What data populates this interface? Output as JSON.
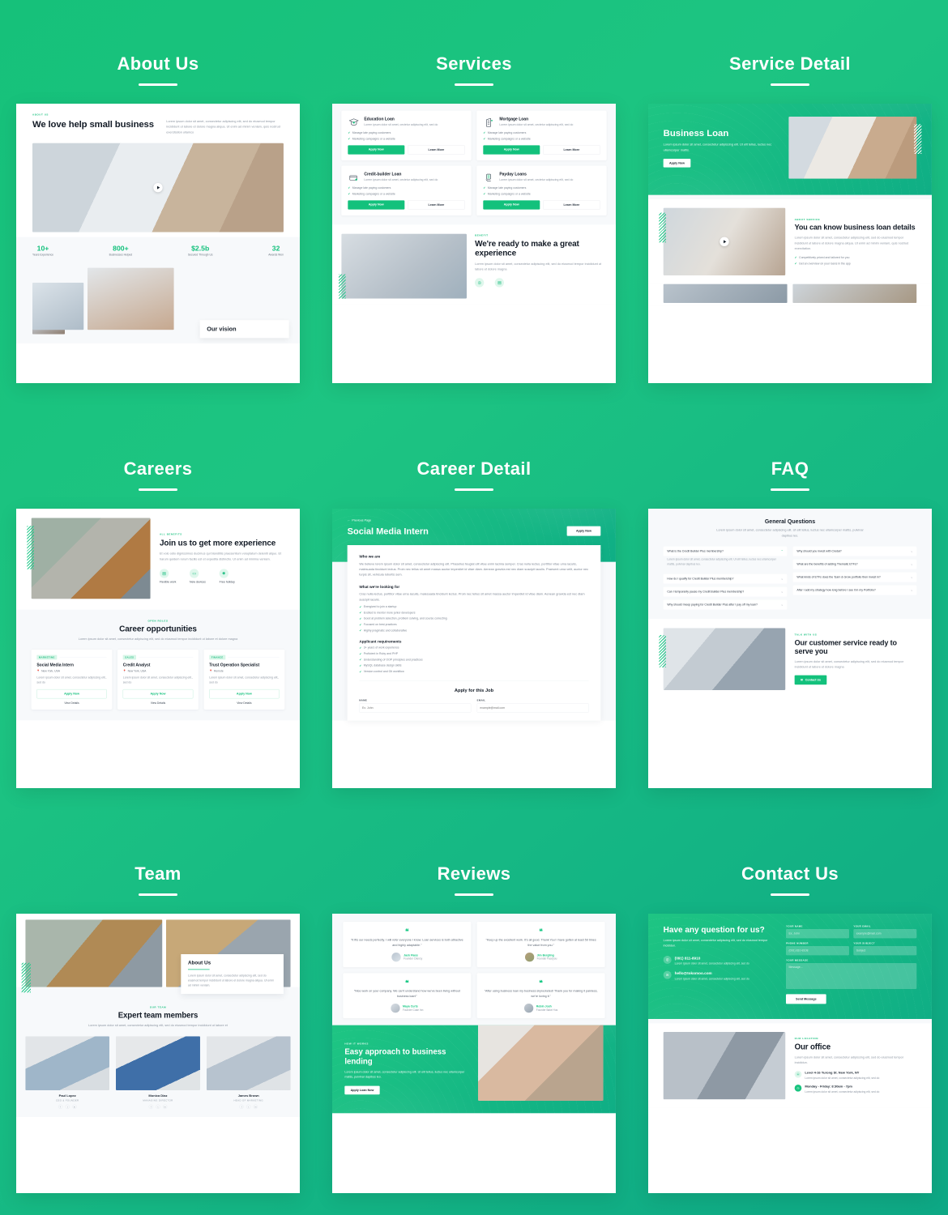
{
  "palette": {
    "brand": "#16c17a",
    "brand_dark": "#0ea885",
    "dark": "#141c27",
    "muted": "#8e97a3"
  },
  "sections": [
    {
      "title": "About Us"
    },
    {
      "title": "Services"
    },
    {
      "title": "Service Detail"
    },
    {
      "title": "Careers"
    },
    {
      "title": "Career Detail"
    },
    {
      "title": "FAQ"
    },
    {
      "title": "Team"
    },
    {
      "title": "Reviews"
    },
    {
      "title": "Contact Us"
    }
  ],
  "about": {
    "eyebrow": "ABOUT US",
    "heading": "We love help small business",
    "paragraph": "Lorem ipsum dolor sit amet, consectetur adipiscing elit, sed do eiusmod tempor incididunt ut labore et dolore magna aliqua. Ut enim ad minim veniam, quis nostrud exercitation ullamco",
    "stats": [
      {
        "value": "10+",
        "label": "Years Experience"
      },
      {
        "value": "800+",
        "label": "Businesses Helped"
      },
      {
        "value": "$2.5b",
        "label": "Secured Through Us"
      },
      {
        "value": "32",
        "label": "Awards Won"
      }
    ],
    "vision_title": "Our vision"
  },
  "services": {
    "cards": [
      {
        "title": "Education Loan",
        "desc": "Lorem ipsum dolor sit amet, cectetur adipiscing elit, sed do",
        "features": [
          "Manage late paying customers",
          "Marketing campaigns or a website"
        ],
        "apply": "Apply Now",
        "learn": "Learn More",
        "icon": "graduation-cap-icon"
      },
      {
        "title": "Mortgage Loan",
        "desc": "Lorem ipsum dolor sit amet, cectetur adipiscing elit, sed do",
        "features": [
          "Manage late paying customers",
          "Marketing campaigns or a website"
        ],
        "apply": "Apply Now",
        "learn": "Learn More",
        "icon": "building-icon"
      },
      {
        "title": "Credit-builder Loan",
        "desc": "Lorem ipsum dolor sit amet, cectetur adipiscing elit, sed do",
        "features": [
          "Manage late paying customers",
          "Marketing campaigns or a website"
        ],
        "apply": "Apply Now",
        "learn": "Learn More",
        "icon": "credit-card-icon"
      },
      {
        "title": "Payday Loans",
        "desc": "Lorem ipsum dolor sit amet, cectetur adipiscing elit, sed do",
        "features": [
          "Manage late paying customers",
          "Marketing campaigns or a website"
        ],
        "apply": "Apply Now",
        "learn": "Learn More",
        "icon": "cash-hand-icon"
      }
    ],
    "benefit": {
      "eyebrow": "BENEFIT",
      "heading": "We're ready to make a great experience",
      "paragraph": "Lorem ipsum dolor sit amet, consectetur adipiscing elit, sed do eiusmod tempor incididunt ut labore et dolore magna"
    }
  },
  "service_detail": {
    "hero_title": "Business Loan",
    "hero_paragraph": "Lorem ipsum dolor sit amet, consectetur adipiscing elit. Ut elit tellus, luctus nec ullamcorper mattis.",
    "hero_button": "Apply Now",
    "eyebrow": "ABOUT SERVICE",
    "heading": "You can know business loan details",
    "paragraph": "Lorem ipsum dolor sit amet, consectetur adipiscing elit, sed do eiusmod tempor incididunt ut labore et dolore magna aliqua. Ut enim ad minim veniam, quis nostrud exercitation.",
    "features": [
      "Competitively priced and tailored for you",
      "Get an overview on your loans in the app"
    ]
  },
  "careers": {
    "eyebrow": "ALL BENEFITS",
    "heading": "Join us to get more experience",
    "paragraph": "Et volo odio dignissimos ducimus qui blanditiis praesentium voluptatum deleniti atque. Et harum quidem rerum facilis est et expedita distinctio. Ut enim ad minima veniam.",
    "benefits": [
      {
        "label": "Flexible work",
        "icon": "calendar-icon"
      },
      {
        "label": "New devices",
        "icon": "laptop-icon"
      },
      {
        "label": "Free holiday",
        "icon": "sun-icon"
      }
    ],
    "roles_eyebrow": "OPEN ROLES",
    "roles_heading": "Career opportunities",
    "roles_paragraph": "Lorem ipsum dolor sit amet, consectetur adipiscing elit, sed do eiusmod tempor incididunt ut labore et dolore magna",
    "roles": [
      {
        "tag": "MARKETING",
        "title": "Social Media Intern",
        "location": "New York, USA",
        "desc": "Lorem ipsum dolor sit amet, consectetur adipiscing elit., sed do",
        "apply": "Apply Now",
        "details": "View Details"
      },
      {
        "tag": "SALES",
        "title": "Credit Analyst",
        "location": "New York, USA",
        "desc": "Lorem ipsum dolor sit amet, consectetur adipiscing elit., sed do",
        "apply": "Apply Now",
        "details": "View Details"
      },
      {
        "tag": "FINANCE",
        "title": "Trust Operation Specialist",
        "location": "Remote",
        "desc": "Lorem ipsum dolor sit amet, consectetur adipiscing elit., sed do",
        "apply": "Apply Now",
        "details": "View Details"
      }
    ]
  },
  "career_detail": {
    "back": "Previous Page",
    "title": "Social Media Intern",
    "apply_button": "Apply Now",
    "who_title": "Who we are",
    "who_text": "We believe lorem ipsum dolor sit amet, consectetur adipiscing elit. Phasellus feugiat elit vitae enim lacinia semper. Cras nulla lectus, porttitor vitae urna iaculis, malesuada tincidunt lectus. Proin nec tellus sit amet massa auctor imperdiet id vitae diam. Aenean gravida est nec diam suscipit iaculis. Praesent urna velit, auctor nec turpis sit, vehicula lobortis sem.",
    "looking_title": "What we're looking for",
    "looking_text": "Cras nulla lectus, porttitor vitae urna iaculis, malesuada tincidunt lectus. Proin nec tellus sit amet massa auctor imperdiet id vitae diam. Aenean gravida est nec diam suscipit iaculis.",
    "looking_items": [
      "Energized to join a startup",
      "Excited to mentor more junior developers",
      "Good at problem selection, problem solving, and course correcting",
      "Focused on best practices",
      "Highly pragmatic and collaborative"
    ],
    "req_title": "Applicant requirements",
    "req_items": [
      "3+ years of work experience",
      "Proficient in Ruby and PHP",
      "Understanding of OOP principles and practices",
      "MySQL database design skills",
      "Version control and Git workflow"
    ],
    "form_title": "Apply for this Job",
    "fields": [
      {
        "label": "NAME",
        "placeholder": "Ex. John"
      },
      {
        "label": "EMAIL",
        "placeholder": "example@mail.com"
      }
    ]
  },
  "faq": {
    "heading": "General Questions",
    "paragraph": "Lorem ipsum dolor sit amet, consectetur adipiscing elit. Ut elit tellus, luctus nec ullamcorper mattis, pulvinar dapibus leo.",
    "left_items": [
      {
        "q": "What is the Credit Builder Plus membership?",
        "open": true,
        "a": "Lorem ipsum dolor sit amet, consectetur adipiscing elit. Ut elit tellus, luctus nec ullamcorper mattis, pulvinar dapibus leo."
      },
      {
        "q": "How do I qualify for Credit Builder Plus membership?",
        "open": false
      },
      {
        "q": "Can I temporarily pause my Credit Builder Plus membership?",
        "open": false
      },
      {
        "q": "Why should I keep paying for Credit Builder Plus after I pay off my loan?",
        "open": false
      }
    ],
    "right_items": [
      {
        "q": "Why should you invest with Credai?",
        "open": false
      },
      {
        "q": "What are the benefits of adding Thematic ETFs?",
        "open": false
      },
      {
        "q": "What kinds of ETFs does the 'Earn & Grow portfolio then invest in?",
        "open": false
      },
      {
        "q": "After I add my strategy how long before I see it in my Portfolio?",
        "open": false
      }
    ],
    "cta_eyebrow": "TALK WITH US",
    "cta_heading": "Our customer service ready to serve you",
    "cta_paragraph": "Lorem ipsum dolor sit amet, consectetur adipiscing elit, sed do eiusmod tempor incididunt ut labore et dolore magna",
    "cta_button": "Contact Us"
  },
  "team": {
    "about_title": "About Us",
    "about_text": "Lorem ipsum dolor sit amet, consectetur adipiscing elit, sed do eiusmod tempor incididunt ut labore et dolore magna aliqua. Ut enim ad minim veniam.",
    "eyebrow": "OUR TEAM",
    "heading": "Expert team members",
    "paragraph": "Lorem ipsum dolor sit amet, consectetur adipiscing elit, sed do eiusmod tempor incididunt ut labore et",
    "members": [
      {
        "name": "Paul Lopez",
        "role": "CEO & FOUNDER"
      },
      {
        "name": "Monica Diaz",
        "role": "MANAGING DIRECTOR"
      },
      {
        "name": "James Brown",
        "role": "HEAD OF MARKETING"
      }
    ],
    "socials": [
      "facebook-icon",
      "twitter-icon",
      "linkedin-icon"
    ]
  },
  "reviews": {
    "items": [
      {
        "quote": "\"It fits our needs perfectly. I will refer everyone I know. Loan services is both attractive and highly adaptable.\"",
        "name": "Jack Flass",
        "role": "Founder Cliency"
      },
      {
        "quote": "\"Keep up the excellent work. It's all good. Thank You! I have gotten at least 50 times the value from you.\"",
        "name": "Jim Bergling",
        "role": "Founder Faceyou"
      },
      {
        "quote": "\"Nice work on your company. We can't understand how we've been living without business loan!\"",
        "name": "Maya Curts",
        "role": "Founder Cake Inn"
      },
      {
        "quote": "\"After using business loan my business skyrocketed! Thank you for making it painless, we're loving it.\"",
        "name": "Robin Josh",
        "role": "Founder Bake Hus"
      }
    ],
    "cta_eyebrow": "HOW IT WORKS",
    "cta_heading": "Easy approach to business lending",
    "cta_paragraph": "Lorem ipsum dolor sit amet, consectetur adipiscing elit. Ut elit tellus, luctus nec ullamcorper mattis, pulvinar dapibus leo.",
    "cta_button": "Apply Loan Now"
  },
  "contact": {
    "heading": "Have any question for us?",
    "paragraph": "Lorem ipsum dolor sit amet, consectetur adipiscing elit, sed do eiusmod tempor incididun.",
    "phone": "(091) 811-8910",
    "phone_note": "Lorem ipsum dolor sit amet, consectetur adipiscing elit, sed do",
    "email": "hello@tokomoo.com",
    "email_note": "Lorem ipsum dolor sit amet, consectetur adipiscing elit, sed do",
    "fields": [
      {
        "label": "YOUR NAME",
        "placeholder": "Ex. John"
      },
      {
        "label": "YOUR EMAIL",
        "placeholder": "example@mail.com"
      },
      {
        "label": "PHONE NUMBER",
        "placeholder": "(091) 810-8108"
      },
      {
        "label": "YOUR SUBJECT",
        "placeholder": "Subject"
      }
    ],
    "message_label": "YOUR MESSAGE",
    "message_placeholder": "Message...",
    "send_button": "Send Message",
    "office_eyebrow": "OUR LOCATION",
    "office_heading": "Our office",
    "office_paragraph": "Lorem ipsum dolor sit amet, consectetur adipiscing elit, sed do eiusmod tempor incididun.",
    "office_items": [
      {
        "icon": "pin-icon",
        "title": "Level 4-16 Yurong St. New York, NY",
        "note": "Lorem ipsum dolor sit amet, consectetur adipiscing elit, sed do"
      },
      {
        "icon": "clock-icon",
        "title": "Monday - Friday: 8:30am - 7pm",
        "note": "Lorem ipsum dolor sit amet, consectetur adipiscing elit, sed do"
      }
    ]
  }
}
